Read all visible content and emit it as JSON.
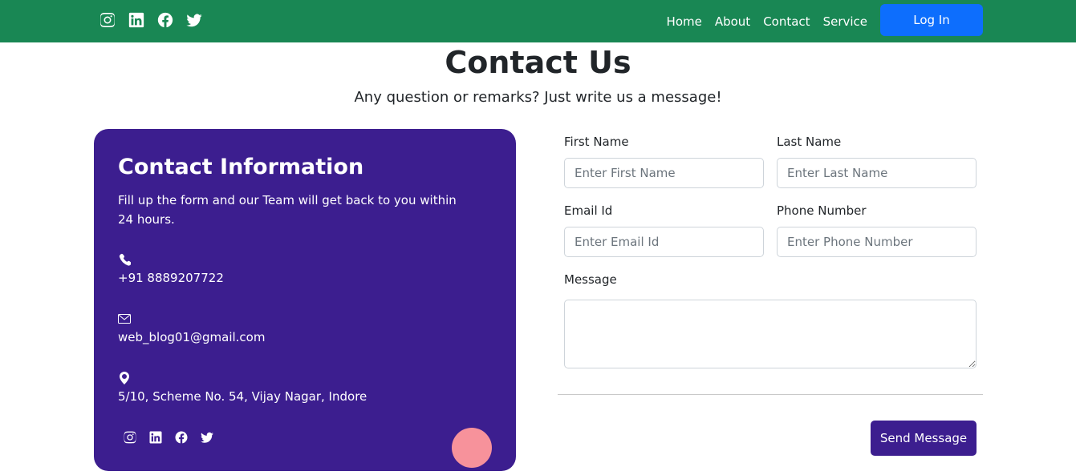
{
  "colors": {
    "nav_bg": "#198754",
    "accent": "#3c1e8f",
    "login_btn": "#0d6efd",
    "deco_circle": "#f7929b"
  },
  "nav": {
    "social_icons": [
      "instagram-icon",
      "linkedin-icon",
      "facebook-icon",
      "twitter-icon"
    ],
    "links": [
      "Home",
      "About",
      "Contact",
      "Service"
    ],
    "login_label": "Log In"
  },
  "header": {
    "title": "Contact Us",
    "subtitle": "Any question or remarks? Just write us a message!"
  },
  "info_card": {
    "title": "Contact Information",
    "description": "Fill up the form and our Team will get back to you within 24 hours.",
    "phone": "+91 8889207722",
    "email": "web_blog01@gmail.com",
    "address": "5/10, Scheme No. 54, Vijay Nagar, Indore",
    "social_icons": [
      "instagram-icon",
      "linkedin-icon",
      "facebook-icon",
      "twitter-icon"
    ]
  },
  "form": {
    "first_name": {
      "label": "First Name",
      "placeholder": "Enter First Name",
      "value": ""
    },
    "last_name": {
      "label": "Last Name",
      "placeholder": "Enter Last Name",
      "value": ""
    },
    "email": {
      "label": "Email Id",
      "placeholder": "Enter Email Id",
      "value": ""
    },
    "phone": {
      "label": "Phone Number",
      "placeholder": "Enter Phone Number",
      "value": ""
    },
    "message": {
      "label": "Message",
      "value": ""
    },
    "submit_label": "Send Message"
  }
}
